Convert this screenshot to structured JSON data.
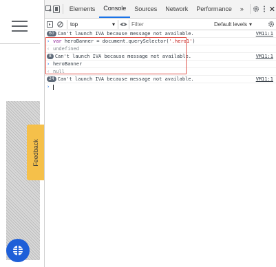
{
  "devtools": {
    "tabs": [
      {
        "label": "Elements"
      },
      {
        "label": "Console",
        "active": true
      },
      {
        "label": "Sources"
      },
      {
        "label": "Network"
      },
      {
        "label": "Performance"
      }
    ],
    "overflow": "»",
    "close": "✕",
    "filter_bar": {
      "context": "top",
      "filter_placeholder": "Filter",
      "levels": "Default levels"
    }
  },
  "console": {
    "lines": [
      {
        "badge": "60",
        "text": "Can't launch IVA because message not available.",
        "source": "VM11:1"
      },
      {
        "input_prefix": "var ",
        "input_name": "heroBanner",
        "input_mid": " = document.querySelector(",
        "input_str": "'.hero1'",
        "input_end": ")"
      },
      {
        "output": "undefined"
      },
      {
        "badge": "8",
        "text": "Can't launch IVA because message not available.",
        "source": "VM11:1"
      },
      {
        "input": "heroBanner"
      },
      {
        "output": "null"
      },
      {
        "badge": "24",
        "text": "Can't launch IVA because message not available.",
        "source": "VM11:1"
      }
    ]
  },
  "page": {
    "feedback_label": "Feedback"
  },
  "colors": {
    "accent": "#1a73e8",
    "feedback": "#f5c04a",
    "chat_button": "#1e5fd8",
    "highlight_border": "#e0544c"
  },
  "icons": {
    "inspect": "inspect-element-icon",
    "device": "device-toolbar-icon",
    "settings": "gear-icon",
    "more": "kebab-menu-icon",
    "sidebar": "show-sidebar-icon",
    "clear": "clear-console-icon",
    "eye": "live-expression-eye-icon"
  }
}
